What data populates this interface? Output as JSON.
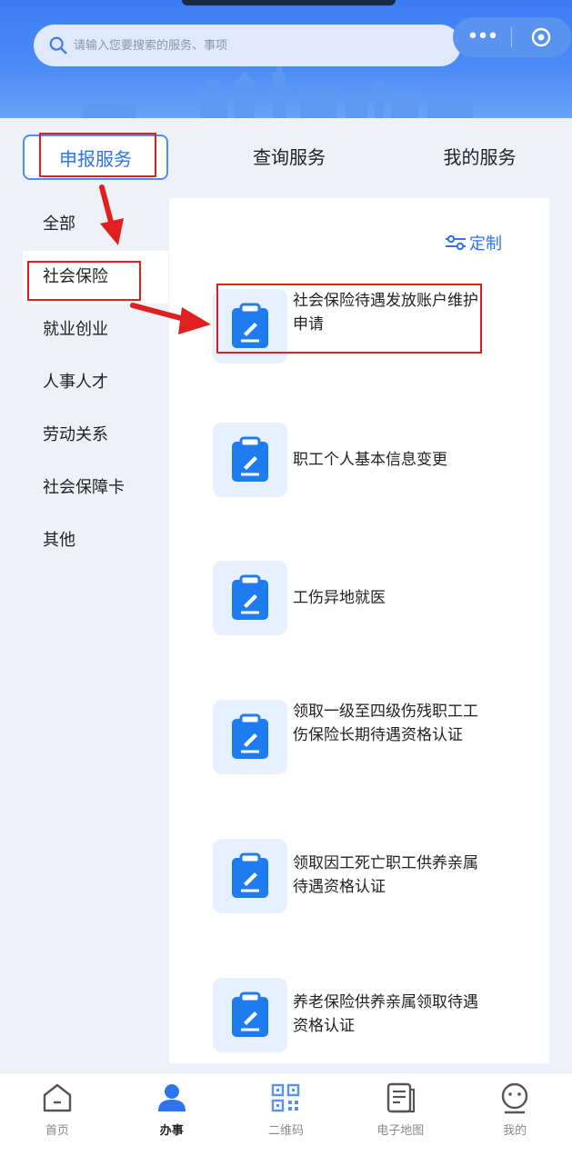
{
  "search": {
    "placeholder": "请输入您要搜索的服务、事项"
  },
  "capsule": {
    "more": "•••",
    "close_icon": "target-icon"
  },
  "tabs": [
    {
      "label": "申报服务",
      "active": true
    },
    {
      "label": "查询服务"
    },
    {
      "label": "我的服务"
    }
  ],
  "categories": [
    {
      "label": "全部"
    },
    {
      "label": "社会保险",
      "active": true
    },
    {
      "label": "就业创业"
    },
    {
      "label": "人事人才"
    },
    {
      "label": "劳动关系"
    },
    {
      "label": "社会保障卡"
    },
    {
      "label": "其他"
    }
  ],
  "customize": {
    "label": "定制",
    "icon": "sliders-icon"
  },
  "services": [
    {
      "label": "社会保险待遇发放账户维护申请",
      "icon": "clipboard-edit-icon"
    },
    {
      "label": "职工个人基本信息变更",
      "icon": "clipboard-edit-icon"
    },
    {
      "label": "工伤异地就医",
      "icon": "clipboard-edit-icon"
    },
    {
      "label": "领取一级至四级伤残职工工伤保险长期待遇资格认证",
      "icon": "clipboard-edit-icon"
    },
    {
      "label": "领取因工死亡职工供养亲属待遇资格认证",
      "icon": "clipboard-edit-icon"
    },
    {
      "label": "养老保险供养亲属领取待遇资格认证",
      "icon": "clipboard-edit-icon"
    }
  ],
  "bottom_nav": [
    {
      "label": "首页",
      "icon": "home-icon"
    },
    {
      "label": "办事",
      "icon": "person-icon",
      "active": true
    },
    {
      "label": "二维码",
      "icon": "qrcode-icon"
    },
    {
      "label": "电子地图",
      "icon": "map-doc-icon"
    },
    {
      "label": "我的",
      "icon": "smiley-icon"
    }
  ],
  "colors": {
    "brand": "#2f74ef",
    "annotation": "#e02020"
  }
}
